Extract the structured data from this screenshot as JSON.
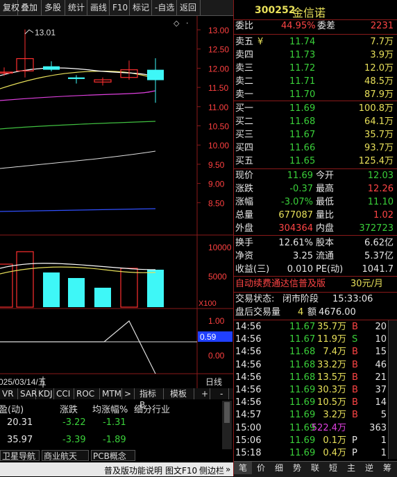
{
  "toolbar": [
    "复权",
    "叠加",
    "多股",
    "统计",
    "画线",
    "F10",
    "标记",
    "-自选",
    "返回"
  ],
  "chart": {
    "y_labels": [
      "13.00",
      "12.50",
      "12.00",
      "11.50",
      "11.00",
      "10.50",
      "10.00",
      "9.50",
      "9.00",
      "8.50"
    ],
    "high_label": "13.01",
    "vol_labels": [
      "10000",
      "5000"
    ],
    "vol_unit": "X100",
    "ind_labels": [
      "1.00",
      "0.50",
      "0.00"
    ],
    "ind_value": "0.59",
    "date": "025/03/14/五",
    "period": "日线",
    "colors": {
      "up": "#ff3030",
      "down": "#3ef7f7",
      "ma5": "#ffffff",
      "ma10": "#e8e05a",
      "ma20": "#e040e0",
      "ma30": "#40c040",
      "ma60": "#e0e0e0",
      "ma120": "#3050ff"
    }
  },
  "indicator_tabs": [
    "VR",
    "SAR",
    "KDJ",
    "CCI",
    "ROC",
    "MTM",
    ">",
    "指标B",
    "模板",
    "+",
    "-"
  ],
  "industry": {
    "headers": [
      "盈(动)",
      "涨跌",
      "均涨幅%",
      "细分行业"
    ],
    "rows": [
      [
        "20.31",
        "-3.22",
        "-1.31"
      ],
      [
        "35.97",
        "-3.39",
        "-1.89"
      ]
    ]
  },
  "bottom_tabs": [
    "卫星导航",
    "商业航天",
    "PCB概念"
  ],
  "footer": {
    "text1": "普及版功能说明",
    "text2": "图文F10",
    "text3": "侧边栏",
    "arrow": "»"
  },
  "quote": {
    "code": "300252",
    "name": "金信诺",
    "weibi_label": "委比",
    "weibi": "44.95%",
    "weicha_label": "委差",
    "weicha": "2231",
    "sells": [
      {
        "label": "卖五",
        "price": "11.74",
        "vol": "7.7万",
        "mark": "¥"
      },
      {
        "label": "卖四",
        "price": "11.73",
        "vol": "3.9万"
      },
      {
        "label": "卖三",
        "price": "11.72",
        "vol": "12.0万"
      },
      {
        "label": "卖二",
        "price": "11.71",
        "vol": "48.5万"
      },
      {
        "label": "卖一",
        "price": "11.70",
        "vol": "87.9万"
      }
    ],
    "buys": [
      {
        "label": "买一",
        "price": "11.69",
        "vol": "100.8万"
      },
      {
        "label": "买二",
        "price": "11.68",
        "vol": "64.1万"
      },
      {
        "label": "买三",
        "price": "11.67",
        "vol": "35.7万"
      },
      {
        "label": "买四",
        "price": "11.66",
        "vol": "93.7万"
      },
      {
        "label": "买五",
        "price": "11.65",
        "vol": "125.4万"
      }
    ],
    "stats": [
      {
        "l1": "现价",
        "v1": "11.69",
        "l2": "今开",
        "v2": "12.03"
      },
      {
        "l1": "涨跌",
        "v1": "-0.37",
        "l2": "最高",
        "v2": "12.26"
      },
      {
        "l1": "涨幅",
        "v1": "-3.07%",
        "l2": "最低",
        "v2": "11.10"
      },
      {
        "l1": "总量",
        "v1": "677087",
        "l2": "量比",
        "v2": "1.02"
      },
      {
        "l1": "外盘",
        "v1": "304364",
        "l2": "内盘",
        "v2": "372723"
      }
    ],
    "stats2": [
      {
        "l1": "换手",
        "v1": "12.61%",
        "l2": "股本",
        "v2": "6.62亿"
      },
      {
        "l1": "净资",
        "v1": "3.25",
        "l2": "流通",
        "v2": "5.37亿"
      },
      {
        "l1": "收益(三)",
        "v1": "0.010",
        "l2": "PE(动)",
        "v2": "1041.7"
      }
    ],
    "ad": {
      "text": "自动续费通达信普及版",
      "price": "30元/月"
    },
    "status_label": "交易状态:",
    "status_value": "闭市阶段",
    "status_time": "15:33:06",
    "after_label": "盘后交易量",
    "after_vol": "4",
    "after_amt_label": "额",
    "after_amt": "4676.00"
  },
  "ticks": [
    {
      "t": "14:56",
      "p": "11.67",
      "v": "35.7万",
      "d": "B",
      "n": "20"
    },
    {
      "t": "14:56",
      "p": "11.67",
      "v": "11.9万",
      "d": "S",
      "n": "10"
    },
    {
      "t": "14:56",
      "p": "11.68",
      "v": "7.4万",
      "d": "B",
      "n": "15"
    },
    {
      "t": "14:56",
      "p": "11.68",
      "v": "33.2万",
      "d": "B",
      "n": "46"
    },
    {
      "t": "14:56",
      "p": "11.68",
      "v": "13.5万",
      "d": "B",
      "n": "21"
    },
    {
      "t": "14:56",
      "p": "11.69",
      "v": "30.3万",
      "d": "B",
      "n": "37"
    },
    {
      "t": "14:56",
      "p": "11.69",
      "v": "10.5万",
      "d": "B",
      "n": "14"
    },
    {
      "t": "14:57",
      "p": "11.69",
      "v": "3.2万",
      "d": "B",
      "n": "5"
    },
    {
      "t": "15:00",
      "p": "11.69",
      "v": "522.4万",
      "d": "",
      "n": "363"
    },
    {
      "t": "15:06",
      "p": "11.69",
      "v": "0.1万",
      "d": "P",
      "n": "1"
    },
    {
      "t": "15:18",
      "p": "11.69",
      "v": "0.4万",
      "d": "P",
      "n": "1"
    }
  ],
  "bottom_nav": [
    "笔",
    "价",
    "细",
    "势",
    "联",
    "短",
    "主",
    "逆",
    "筹"
  ]
}
